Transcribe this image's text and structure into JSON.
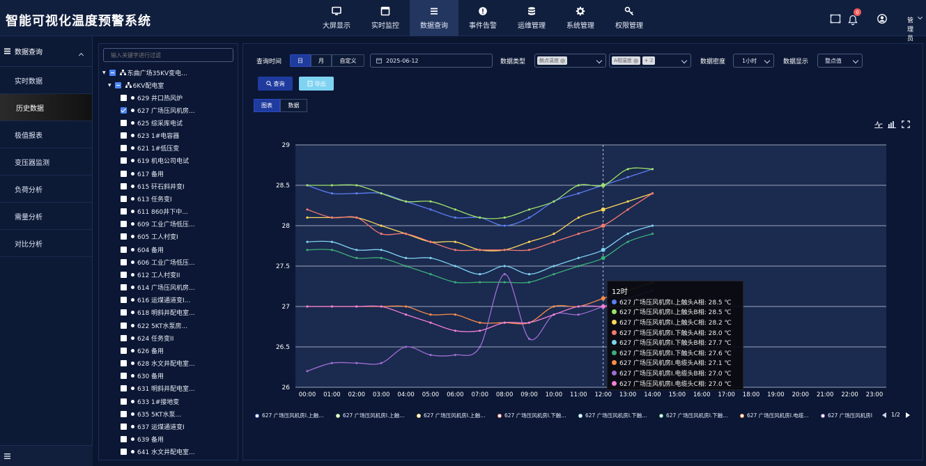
{
  "app_title": "智能可视化温度预警系统",
  "nav": [
    {
      "label": "大屏显示",
      "icon": "monitor-icon"
    },
    {
      "label": "实时监控",
      "icon": "window-icon"
    },
    {
      "label": "数据查询",
      "icon": "list-icon"
    },
    {
      "label": "事件告警",
      "icon": "alert-icon"
    },
    {
      "label": "运维管理",
      "icon": "database-icon"
    },
    {
      "label": "系统管理",
      "icon": "gear-icon"
    },
    {
      "label": "权限管理",
      "icon": "key-icon"
    }
  ],
  "header_right": {
    "notification_count": "0",
    "user": "管理员"
  },
  "sidebar": {
    "section": "数据查询",
    "items": [
      "实时数据",
      "历史数据",
      "极值报表",
      "变压器监测",
      "负荷分析",
      "需量分析",
      "对比分析"
    ],
    "active_index": 1
  },
  "tree": {
    "search_placeholder": "输入关键字进行过滤",
    "root": "东曲广场35KV变电...",
    "sub": "6KV配电室",
    "nodes": [
      "629 井口热风炉",
      "627 广场压风机房...",
      "625 综采库电试",
      "623 1#电容器",
      "621 1#低压变",
      "619 机电公司电试",
      "617 备用",
      "615 矸石斜井变I",
      "613 任务变I",
      "611 860井下中...",
      "609 工业广场低压...",
      "605 工人村变I",
      "604 备用",
      "606 工业广场低压...",
      "612 工人村变II",
      "614 广场压风机房...",
      "616 运煤通道变I...",
      "618 明斜井配电室...",
      "622 5KT水泵房...",
      "624 任务变II",
      "626 备用",
      "628 水文井配电室...",
      "630 备用",
      "631 明斜井配电室...",
      "633 1#接地变",
      "635 5KT水泵...",
      "637 运煤通道变I",
      "639 备用",
      "641 水文井配电室..."
    ],
    "checked_index": 1
  },
  "query": {
    "time_label": "查询时间",
    "time_modes": [
      "日",
      "月",
      "自定义"
    ],
    "active_mode": 0,
    "date": "2025-06-12",
    "type_label": "数据类型",
    "type_tag": "触点温度",
    "phase_tag": "A相温度",
    "phase_more": "+ 2",
    "density_label": "数据密度",
    "density_value": "1小时",
    "display_label": "数据显示",
    "display_value": "整点值",
    "query_button": "查询",
    "export_button": "导出",
    "view_tabs": [
      "图表",
      "数据"
    ],
    "active_view": 0
  },
  "colors": {
    "s1": "#5b7ff2",
    "s2": "#9de26a",
    "s3": "#fdd75a",
    "s4": "#f27a72",
    "s5": "#7fd3f2",
    "s6": "#3cae78",
    "s7": "#fb8d4a",
    "s8": "#9d6ed2",
    "s9": "#f07fd6"
  },
  "chart_data": {
    "type": "line",
    "x": [
      "00:00",
      "01:00",
      "02:00",
      "03:00",
      "04:00",
      "05:00",
      "06:00",
      "07:00",
      "08:00",
      "09:00",
      "10:00",
      "11:00",
      "12:00",
      "13:00",
      "14:00",
      "15:00",
      "16:00",
      "17:00",
      "18:00",
      "19:00",
      "20:00",
      "21:00",
      "22:00",
      "23:00"
    ],
    "ylim": [
      26,
      29
    ],
    "yticks": [
      "26",
      "26.5",
      "27",
      "27.5",
      "28",
      "28.5",
      "29"
    ],
    "series": [
      {
        "name": "627 广场压风机房I.上触头A相",
        "values": [
          28.5,
          28.4,
          28.4,
          28.4,
          28.3,
          28.2,
          28.1,
          28.1,
          28.0,
          28.1,
          28.3,
          28.4,
          28.5,
          28.6,
          28.7
        ]
      },
      {
        "name": "627 广场压风机房I.上触头B相",
        "values": [
          28.5,
          28.5,
          28.5,
          28.4,
          28.3,
          28.3,
          28.2,
          28.1,
          28.1,
          28.2,
          28.3,
          28.5,
          28.5,
          28.7,
          28.7
        ]
      },
      {
        "name": "627 广场压风机房I.上触头C相",
        "values": [
          28.1,
          28.1,
          28.1,
          28.0,
          27.9,
          27.8,
          27.8,
          27.7,
          27.7,
          27.8,
          27.9,
          28.1,
          28.2,
          28.3,
          28.4
        ]
      },
      {
        "name": "627 广场压风机房I.下触头A相",
        "values": [
          28.2,
          28.1,
          28.1,
          27.9,
          27.9,
          27.8,
          27.7,
          27.7,
          27.7,
          27.7,
          27.8,
          27.9,
          28.0,
          28.2,
          28.4
        ]
      },
      {
        "name": "627 广场压风机房I.下触头B相",
        "values": [
          27.8,
          27.8,
          27.7,
          27.7,
          27.6,
          27.6,
          27.5,
          27.4,
          27.5,
          27.4,
          27.5,
          27.6,
          27.7,
          27.9,
          28.0
        ]
      },
      {
        "name": "627 广场压风机房I.下触头C相",
        "values": [
          27.7,
          27.7,
          27.6,
          27.6,
          27.5,
          27.4,
          27.3,
          27.3,
          27.3,
          27.3,
          27.4,
          27.5,
          27.6,
          27.8,
          27.9
        ]
      },
      {
        "name": "627 广场压风机房I.电缆头A相",
        "values": [
          27.0,
          27.0,
          27.0,
          27.0,
          27.0,
          26.9,
          26.9,
          26.8,
          26.8,
          26.8,
          27.0,
          27.0,
          27.1,
          27.2,
          27.3
        ]
      },
      {
        "name": "627 广场压风机房I.电缆头B相",
        "values": [
          26.2,
          26.3,
          26.3,
          26.3,
          26.5,
          26.4,
          26.4,
          26.5,
          27.4,
          26.6,
          26.9,
          26.9,
          27.0,
          27.1,
          27.2
        ]
      },
      {
        "name": "627 广场压风机房I.电缆头C相",
        "values": [
          27.0,
          27.0,
          27.0,
          27.0,
          26.9,
          26.8,
          26.7,
          26.7,
          26.8,
          26.8,
          26.9,
          27.0,
          27.0,
          27.0,
          27.0
        ]
      }
    ],
    "tooltip": {
      "title": "12时",
      "rows": [
        "627 广场压风机房I.上触头A相:  28.5 ℃",
        "627 广场压风机房I.上触头B相:  28.5 ℃",
        "627 广场压风机房I.上触头C相:  28.2 ℃",
        "627 广场压风机房I.下触头A相:  28.0 ℃",
        "627 广场压风机房I.下触头B相:  27.7 ℃",
        "627 广场压风机房I.下触头C相:  27.6 ℃",
        "627 广场压风机房I.电缆头A相:  27.1 ℃",
        "627 广场压风机房I.电缆头B相:  27.0 ℃",
        "627 广场压风机房I.电缆头C相:  27.0 ℃"
      ]
    },
    "legend": [
      "627 广场压风机房I.上触...",
      "627 广场压风机房I.上触...",
      "627 广场压风机房I.上触...",
      "627 广场压风机房I.下触...",
      "627 广场压风机房I.下触...",
      "627 广场压风机房I.下触...",
      "627 广场压风机房I.电缆...",
      "627 广场压风机房I"
    ],
    "legend_page": "1/2"
  }
}
